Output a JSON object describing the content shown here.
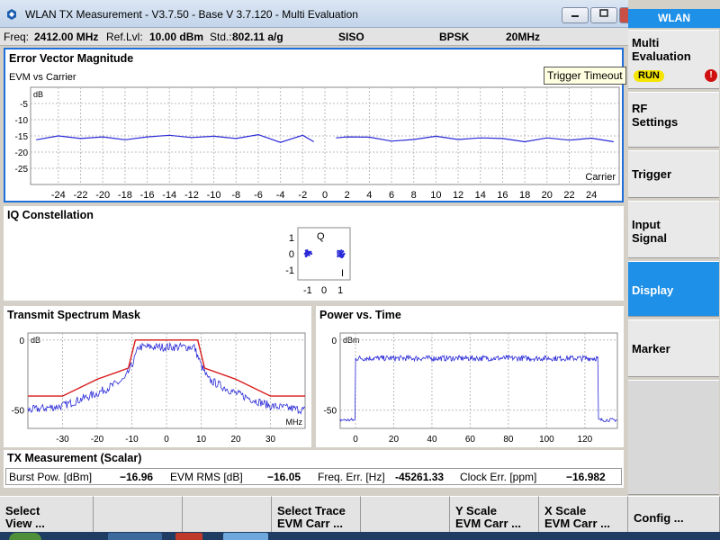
{
  "window": {
    "title": "WLAN TX Measurement  - V3.7.50 - Base V 3.7.120 - Multi Evaluation",
    "minimize_label": "▭",
    "maximize_label": "▭"
  },
  "infobar": {
    "freq_label": "Freq:",
    "freq_value": "2412.00 MHz",
    "reflvl_label": "Ref.Lvl:",
    "reflvl_value": "10.00 dBm",
    "std_label": "Std.:",
    "std_value": "802.11 a/g",
    "mode": "SISO",
    "modulation": "BPSK",
    "bandwidth": "20MHz"
  },
  "evm": {
    "title": "Error Vector Magnitude",
    "subtitle": "EVM vs Carrier",
    "ylabel": "dB",
    "xlabel": "Carrier"
  },
  "iq": {
    "title": "IQ Constellation",
    "q_label": "Q",
    "i_label": "I"
  },
  "tsm": {
    "title": "Transmit Spectrum Mask",
    "ylabel": "dB",
    "xlabel": "MHz"
  },
  "pvt": {
    "title": "Power vs. Time",
    "ylabel": "dBm"
  },
  "scalar": {
    "title": "TX Measurement (Scalar)",
    "burst_label": "Burst Pow. [dBm]",
    "burst_value": "−16.96",
    "evm_label": "EVM RMS [dB]",
    "evm_value": "−16.05",
    "freqerr_label": "Freq. Err. [Hz]",
    "freqerr_value": "-45261.33",
    "clockerr_label": "Clock Err. [ppm]",
    "clockerr_value": "−16.982"
  },
  "tooltip": "Trigger Timeout",
  "softkeys": {
    "header": "WLAN",
    "multi_line1": "Multi",
    "multi_line2": "Evaluation",
    "run_badge": "RUN",
    "warn_icon": "!",
    "rf_line1": "RF",
    "rf_line2": "Settings",
    "trigger": "Trigger",
    "input_line1": "Input",
    "input_line2": "Signal",
    "display": "Display",
    "marker": "Marker"
  },
  "bottom_keys": [
    "Select\nView ...",
    "",
    "",
    "Select Trace\nEVM Carr ...",
    "",
    "Y Scale\nEVM Carr ...",
    "X Scale\nEVM Carr ...",
    "Config ..."
  ],
  "colors": {
    "accent": "#1e90e8",
    "trace": "#2a2ad8",
    "mask": "#d81818"
  },
  "chart_data": [
    {
      "type": "line",
      "title": "Error Vector Magnitude",
      "subtitle": "EVM vs Carrier",
      "ylabel": "dB",
      "xlabel": "Carrier",
      "ylim": [
        -30,
        0
      ],
      "yticks": [
        -5,
        -10,
        -15,
        -20,
        -25
      ],
      "xticks": [
        -24,
        -22,
        -20,
        -18,
        -16,
        -14,
        -12,
        -10,
        -8,
        -6,
        -4,
        -2,
        0,
        2,
        4,
        6,
        8,
        10,
        12,
        14,
        16,
        18,
        20,
        22,
        24
      ],
      "xlim": [
        -26.5,
        26.5
      ],
      "series": [
        {
          "segment": "negative",
          "x": [
            -26,
            -24,
            -22,
            -20,
            -18,
            -16,
            -14,
            -12,
            -10,
            -8,
            -6,
            -4,
            -2,
            -1
          ],
          "y": [
            -16.2,
            -15.0,
            -15.8,
            -15.3,
            -16.2,
            -15.3,
            -14.8,
            -15.5,
            -15.1,
            -15.8,
            -14.6,
            -17.0,
            -14.8,
            -16.8
          ]
        },
        {
          "segment": "positive",
          "x": [
            1,
            2,
            4,
            6,
            8,
            10,
            12,
            14,
            16,
            18,
            20,
            22,
            24,
            26
          ],
          "y": [
            -15.6,
            -15.3,
            -15.4,
            -16.6,
            -16.1,
            -15.1,
            -16.1,
            -15.6,
            -15.8,
            -16.8,
            -15.6,
            -16.3,
            -15.7,
            -16.8
          ]
        }
      ]
    },
    {
      "type": "scatter",
      "title": "IQ Constellation",
      "xticks": [
        -1,
        0,
        1
      ],
      "yticks": [
        1,
        0,
        -1
      ],
      "xlim": [
        -1.6,
        1.6
      ],
      "ylim": [
        -1.6,
        1.6
      ],
      "clusters": [
        {
          "i": -1,
          "q": 0
        },
        {
          "i": 1,
          "q": 0
        }
      ]
    },
    {
      "type": "line",
      "title": "Transmit Spectrum Mask",
      "ylabel": "dB",
      "xlabel": "MHz",
      "xlim": [
        -40,
        40
      ],
      "ylim": [
        -63,
        5
      ],
      "xticks": [
        -30,
        -20,
        -10,
        0,
        10,
        20,
        30
      ],
      "yticks": [
        0,
        -50
      ],
      "mask": {
        "x": [
          -40,
          -30,
          -20,
          -11,
          -9,
          9,
          11,
          20,
          30,
          40
        ],
        "y": [
          -40,
          -40,
          -28,
          -20,
          0,
          0,
          -20,
          -28,
          -40,
          -40
        ]
      },
      "trace_shape": {
        "x": [
          -40,
          -30,
          -20,
          -12,
          -10,
          -8,
          8,
          10,
          12,
          20,
          30,
          40
        ],
        "y": [
          -50,
          -47,
          -38,
          -28,
          -18,
          -5,
          -5,
          -18,
          -28,
          -38,
          -47,
          -50
        ]
      }
    },
    {
      "type": "line",
      "title": "Power vs. Time",
      "ylabel": "dBm",
      "xlim": [
        -8,
        137
      ],
      "ylim": [
        -63,
        5
      ],
      "xticks": [
        0,
        20,
        40,
        60,
        80,
        100,
        120
      ],
      "yticks": [
        0,
        -50
      ],
      "trace_shape": {
        "x": [
          -8,
          -0.5,
          0,
          127,
          127.5,
          137
        ],
        "y": [
          -57,
          -57,
          -13,
          -13,
          -57,
          -57
        ]
      }
    }
  ]
}
